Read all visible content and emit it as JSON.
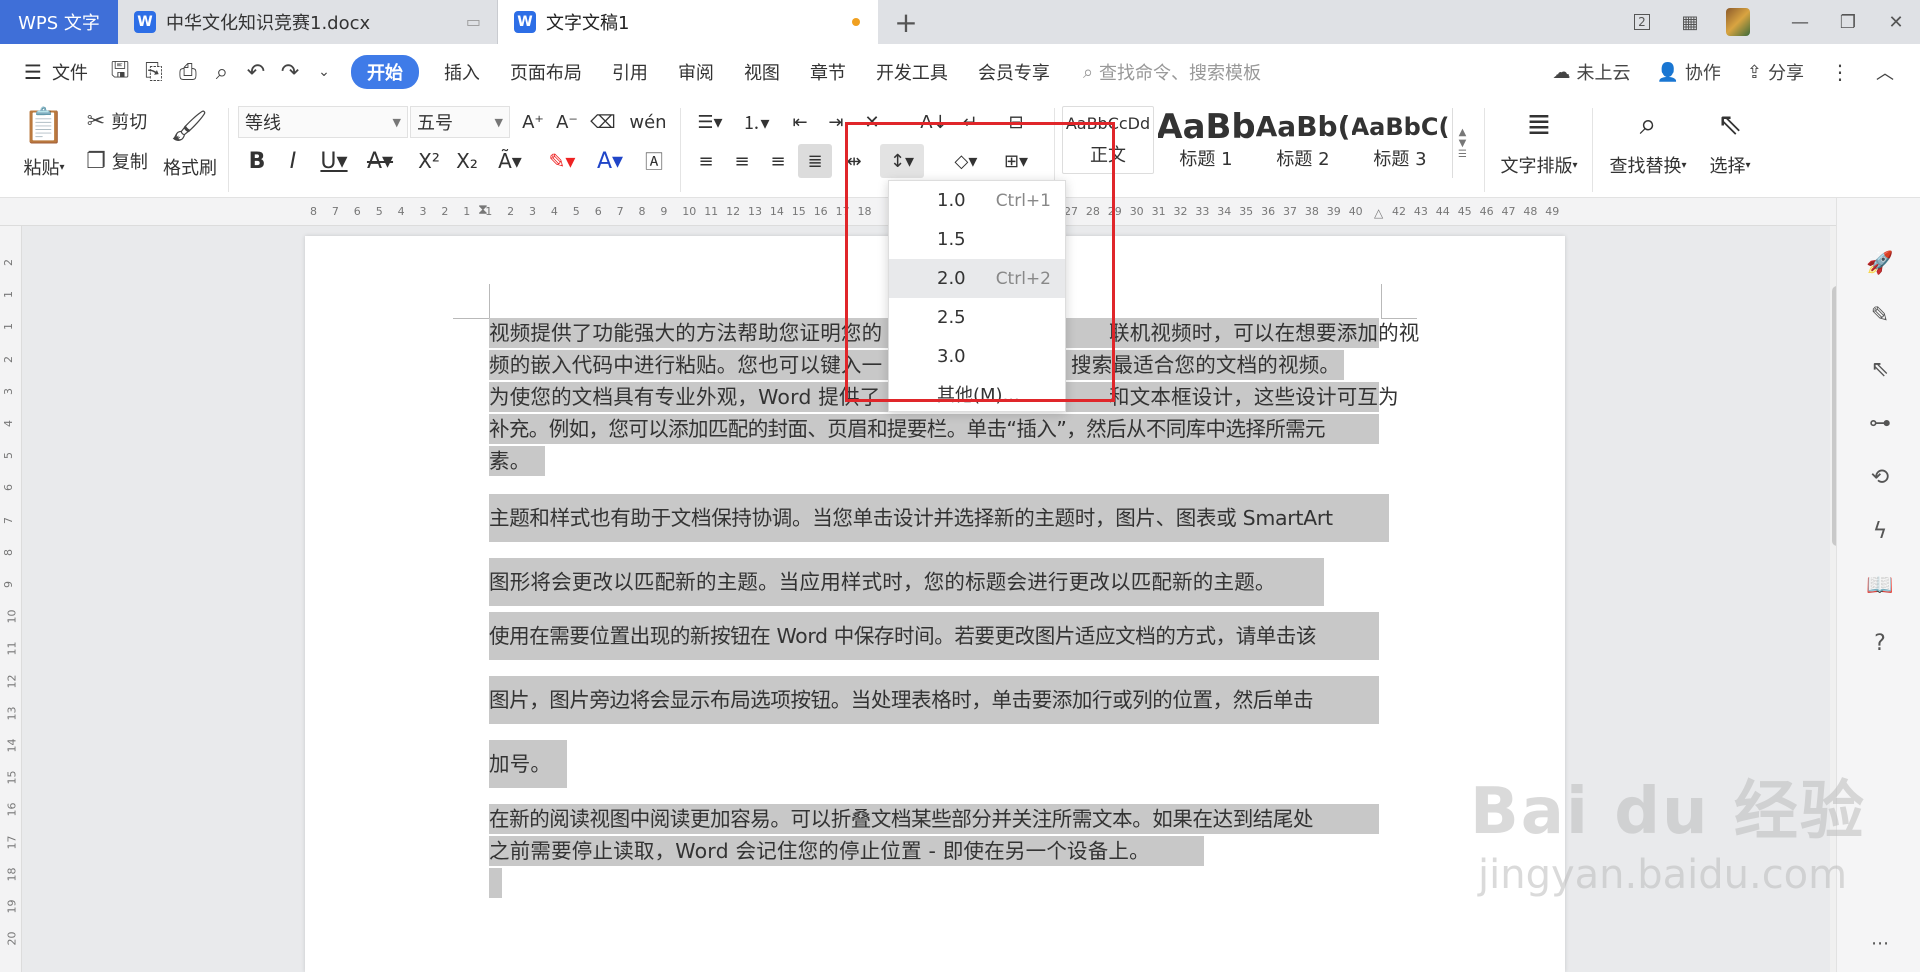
{
  "tabs": {
    "app": "WPS 文字",
    "doc1": "中华文化知识竞赛1.docx",
    "doc2": "文字文稿1",
    "add": "+"
  },
  "menu": {
    "file": "文件",
    "items": [
      "开始",
      "插入",
      "页面布局",
      "引用",
      "审阅",
      "视图",
      "章节",
      "开发工具",
      "会员专享"
    ],
    "search_placeholder": "查找命令、搜索模板",
    "cloud": "未上云",
    "collab": "协作",
    "share": "分享"
  },
  "ribbon": {
    "paste": "粘贴",
    "cut": "剪切",
    "copy": "复制",
    "format_painter": "格式刷",
    "font_name": "等线",
    "font_size": "五号",
    "styles": [
      {
        "preview": "AaBbCcDd",
        "label": "正文"
      },
      {
        "preview": "AaBb",
        "label": "标题 1"
      },
      {
        "preview": "AaBb(",
        "label": "标题 2"
      },
      {
        "preview": "AaBbC(",
        "label": "标题 3"
      }
    ],
    "text_layout": "文字排版",
    "find_replace": "查找替换",
    "select": "选择"
  },
  "line_spacing_menu": {
    "items": [
      {
        "value": "1.0",
        "shortcut": "Ctrl+1"
      },
      {
        "value": "1.5",
        "shortcut": ""
      },
      {
        "value": "2.0",
        "shortcut": "Ctrl+2"
      },
      {
        "value": "2.5",
        "shortcut": ""
      },
      {
        "value": "3.0",
        "shortcut": ""
      },
      {
        "value": "其他(M)...",
        "shortcut": ""
      }
    ],
    "highlighted": "2.0"
  },
  "ruler": {
    "h_ticks": [
      "8",
      "7",
      "6",
      "5",
      "4",
      "3",
      "2",
      "1",
      "1",
      "2",
      "3",
      "4",
      "5",
      "6",
      "7",
      "8",
      "9",
      "10",
      "11",
      "12",
      "13",
      "14",
      "15",
      "16",
      "17",
      "18",
      "27",
      "28",
      "29",
      "30",
      "31",
      "32",
      "33",
      "34",
      "35",
      "36",
      "37",
      "38",
      "39",
      "40",
      "42",
      "43",
      "44",
      "45",
      "46",
      "47",
      "48",
      "49"
    ],
    "v_ticks": [
      "2",
      "1",
      "1",
      "2",
      "3",
      "4",
      "5",
      "6",
      "7",
      "8",
      "9",
      "10",
      "11",
      "12",
      "13",
      "14",
      "15",
      "16",
      "17",
      "18",
      "19",
      "20"
    ]
  },
  "document": {
    "lines": [
      "视频提供了功能强大的方法帮助您证明您的",
      "联机视频时，可以在想要添加的视",
      "频的嵌入代码中进行粘贴。您也可以键入一",
      "搜索最适合您的文档的视频。",
      "为使您的文档具有专业外观，Word 提供了",
      "和文本框设计，这些设计可互为",
      "补充。例如，您可以添加匹配的封面、页眉和提要栏。单击“插入”，然后从不同库中选择所需元",
      "素。",
      "主题和样式也有助于文档保持协调。当您单击设计并选择新的主题时，图片、图表或 SmartArt",
      "图形将会更改以匹配新的主题。当应用样式时，您的标题会进行更改以匹配新的主题。",
      "使用在需要位置出现的新按钮在 Word 中保存时间。若要更改图片适应文档的方式，请单击该",
      "图片，图片旁边将会显示布局选项按钮。当处理表格时，单击要添加行或列的位置，然后单击",
      "加号。",
      "在新的阅读视图中阅读更加容易。可以折叠文档某些部分并关注所需文本。如果在达到结尾处",
      "之前需要停止读取，Word 会记住您的停止位置 - 即使在另一个设备上。"
    ]
  },
  "watermark": {
    "brand": "Bai du 经验",
    "url": "jingyan.baidu.com"
  }
}
